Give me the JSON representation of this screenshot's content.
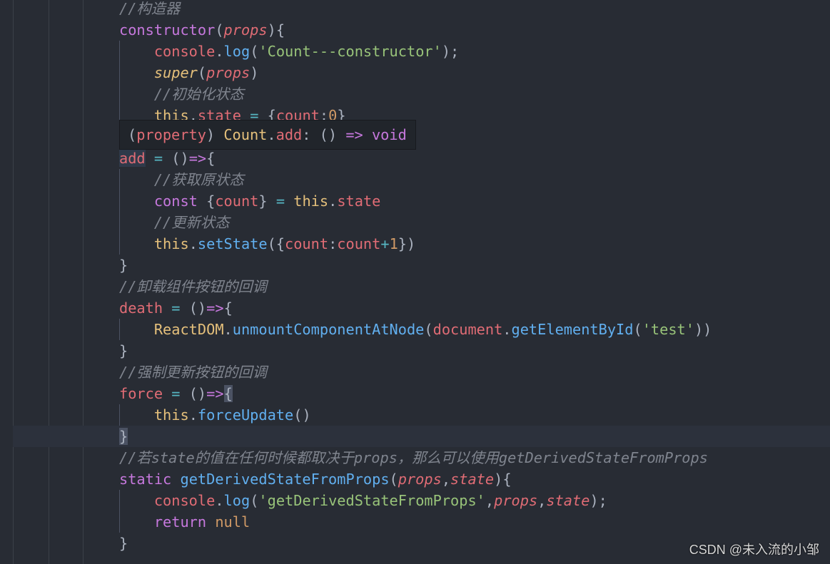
{
  "editor": {
    "colors": {
      "background": "#282c34",
      "comment": "#7f848e",
      "keyword": "#c678dd",
      "variable": "#e06c75",
      "string": "#98c379",
      "function": "#61afef",
      "class": "#e5c07b",
      "operator": "#56b6c2",
      "number": "#d19a66"
    },
    "lines": [
      [
        [
          "c",
          "//构造器"
        ]
      ],
      [
        [
          "p",
          "constructor"
        ],
        [
          "n",
          "("
        ],
        [
          "ri",
          "props"
        ],
        [
          "n",
          "){"
        ]
      ],
      [
        [
          "n",
          "    "
        ],
        [
          "r",
          "console"
        ],
        [
          "n",
          "."
        ],
        [
          "b",
          "log"
        ],
        [
          "n",
          "("
        ],
        [
          "g",
          "'Count---constructor'"
        ],
        [
          "n",
          ");"
        ]
      ],
      [
        [
          "n",
          "    "
        ],
        [
          "yi",
          "super"
        ],
        [
          "n",
          "("
        ],
        [
          "ri",
          "props"
        ],
        [
          "n",
          ")"
        ]
      ],
      [
        [
          "n",
          "    "
        ],
        [
          "c",
          "//初始化状态"
        ]
      ],
      [
        [
          "n",
          "    "
        ],
        [
          "y",
          "this"
        ],
        [
          "n",
          "."
        ],
        [
          "r",
          "state"
        ],
        [
          "n",
          " "
        ],
        [
          "cy",
          "="
        ],
        [
          "n",
          " {"
        ],
        [
          "r",
          "count"
        ],
        [
          "n",
          ":"
        ],
        [
          "o",
          "0"
        ],
        [
          "n",
          "}"
        ]
      ],
      [],
      [
        [
          "r sel",
          "add"
        ],
        [
          "n",
          " "
        ],
        [
          "cy",
          "="
        ],
        [
          "n",
          " ()"
        ],
        [
          "p",
          "=>"
        ],
        [
          "n",
          "{"
        ]
      ],
      [
        [
          "n",
          "    "
        ],
        [
          "c",
          "//获取原状态"
        ]
      ],
      [
        [
          "n",
          "    "
        ],
        [
          "p",
          "const"
        ],
        [
          "n",
          " {"
        ],
        [
          "r",
          "count"
        ],
        [
          "n",
          "} "
        ],
        [
          "cy",
          "="
        ],
        [
          "n",
          " "
        ],
        [
          "y",
          "this"
        ],
        [
          "n",
          "."
        ],
        [
          "r",
          "state"
        ]
      ],
      [
        [
          "n",
          "    "
        ],
        [
          "c",
          "//更新状态"
        ]
      ],
      [
        [
          "n",
          "    "
        ],
        [
          "y",
          "this"
        ],
        [
          "n",
          "."
        ],
        [
          "b",
          "setState"
        ],
        [
          "n",
          "({"
        ],
        [
          "r",
          "count"
        ],
        [
          "n",
          ":"
        ],
        [
          "r",
          "count"
        ],
        [
          "cy",
          "+"
        ],
        [
          "o",
          "1"
        ],
        [
          "n",
          "})"
        ]
      ],
      [
        [
          "n",
          "}"
        ]
      ],
      [
        [
          "c",
          "//卸载组件按钮的回调"
        ]
      ],
      [
        [
          "r",
          "death"
        ],
        [
          "n",
          " "
        ],
        [
          "cy",
          "="
        ],
        [
          "n",
          " ()"
        ],
        [
          "p",
          "=>"
        ],
        [
          "n",
          "{"
        ]
      ],
      [
        [
          "n",
          "    "
        ],
        [
          "y",
          "ReactDOM"
        ],
        [
          "n",
          "."
        ],
        [
          "b",
          "unmountComponentAtNode"
        ],
        [
          "n",
          "("
        ],
        [
          "r",
          "document"
        ],
        [
          "n",
          "."
        ],
        [
          "b",
          "getElementById"
        ],
        [
          "n",
          "("
        ],
        [
          "g",
          "'test'"
        ],
        [
          "n",
          "))"
        ]
      ],
      [
        [
          "n",
          "}"
        ]
      ],
      [
        [
          "c",
          "//强制更新按钮的回调"
        ]
      ],
      [
        [
          "r",
          "force"
        ],
        [
          "n",
          " "
        ],
        [
          "cy",
          "="
        ],
        [
          "n",
          " ()"
        ],
        [
          "p",
          "=>"
        ],
        [
          "n br",
          "{"
        ]
      ],
      [
        [
          "n",
          "    "
        ],
        [
          "y",
          "this"
        ],
        [
          "n",
          "."
        ],
        [
          "b",
          "forceUpdate"
        ],
        [
          "n",
          "()"
        ]
      ],
      [
        [
          "n br",
          "}"
        ]
      ],
      [
        [
          "c",
          "//若state的值在任何时候都取决于props，那么可以使用getDerivedStateFromProps"
        ]
      ],
      [
        [
          "p",
          "static"
        ],
        [
          "n",
          " "
        ],
        [
          "b",
          "getDerivedStateFromProps"
        ],
        [
          "n",
          "("
        ],
        [
          "ri",
          "props"
        ],
        [
          "n",
          ","
        ],
        [
          "ri",
          "state"
        ],
        [
          "n",
          "){"
        ]
      ],
      [
        [
          "n",
          "    "
        ],
        [
          "r",
          "console"
        ],
        [
          "n",
          "."
        ],
        [
          "b",
          "log"
        ],
        [
          "n",
          "("
        ],
        [
          "g",
          "'getDerivedStateFromProps'"
        ],
        [
          "n",
          ","
        ],
        [
          "ri",
          "props"
        ],
        [
          "n",
          ","
        ],
        [
          "ri",
          "state"
        ],
        [
          "n",
          ");"
        ]
      ],
      [
        [
          "n",
          "    "
        ],
        [
          "p",
          "return"
        ],
        [
          "n",
          " "
        ],
        [
          "o",
          "null"
        ]
      ],
      [
        [
          "n",
          "}"
        ]
      ]
    ]
  },
  "hover_tooltip": {
    "tokens": [
      [
        "n",
        "("
      ],
      [
        "r",
        "property"
      ],
      [
        "n",
        ") "
      ],
      [
        "y",
        "Count"
      ],
      [
        "n",
        "."
      ],
      [
        "r",
        "add"
      ],
      [
        "n",
        ": () "
      ],
      [
        "p",
        "=>"
      ],
      [
        "n",
        " "
      ],
      [
        "p",
        "void"
      ]
    ]
  },
  "watermark": "CSDN @未入流的小邹"
}
